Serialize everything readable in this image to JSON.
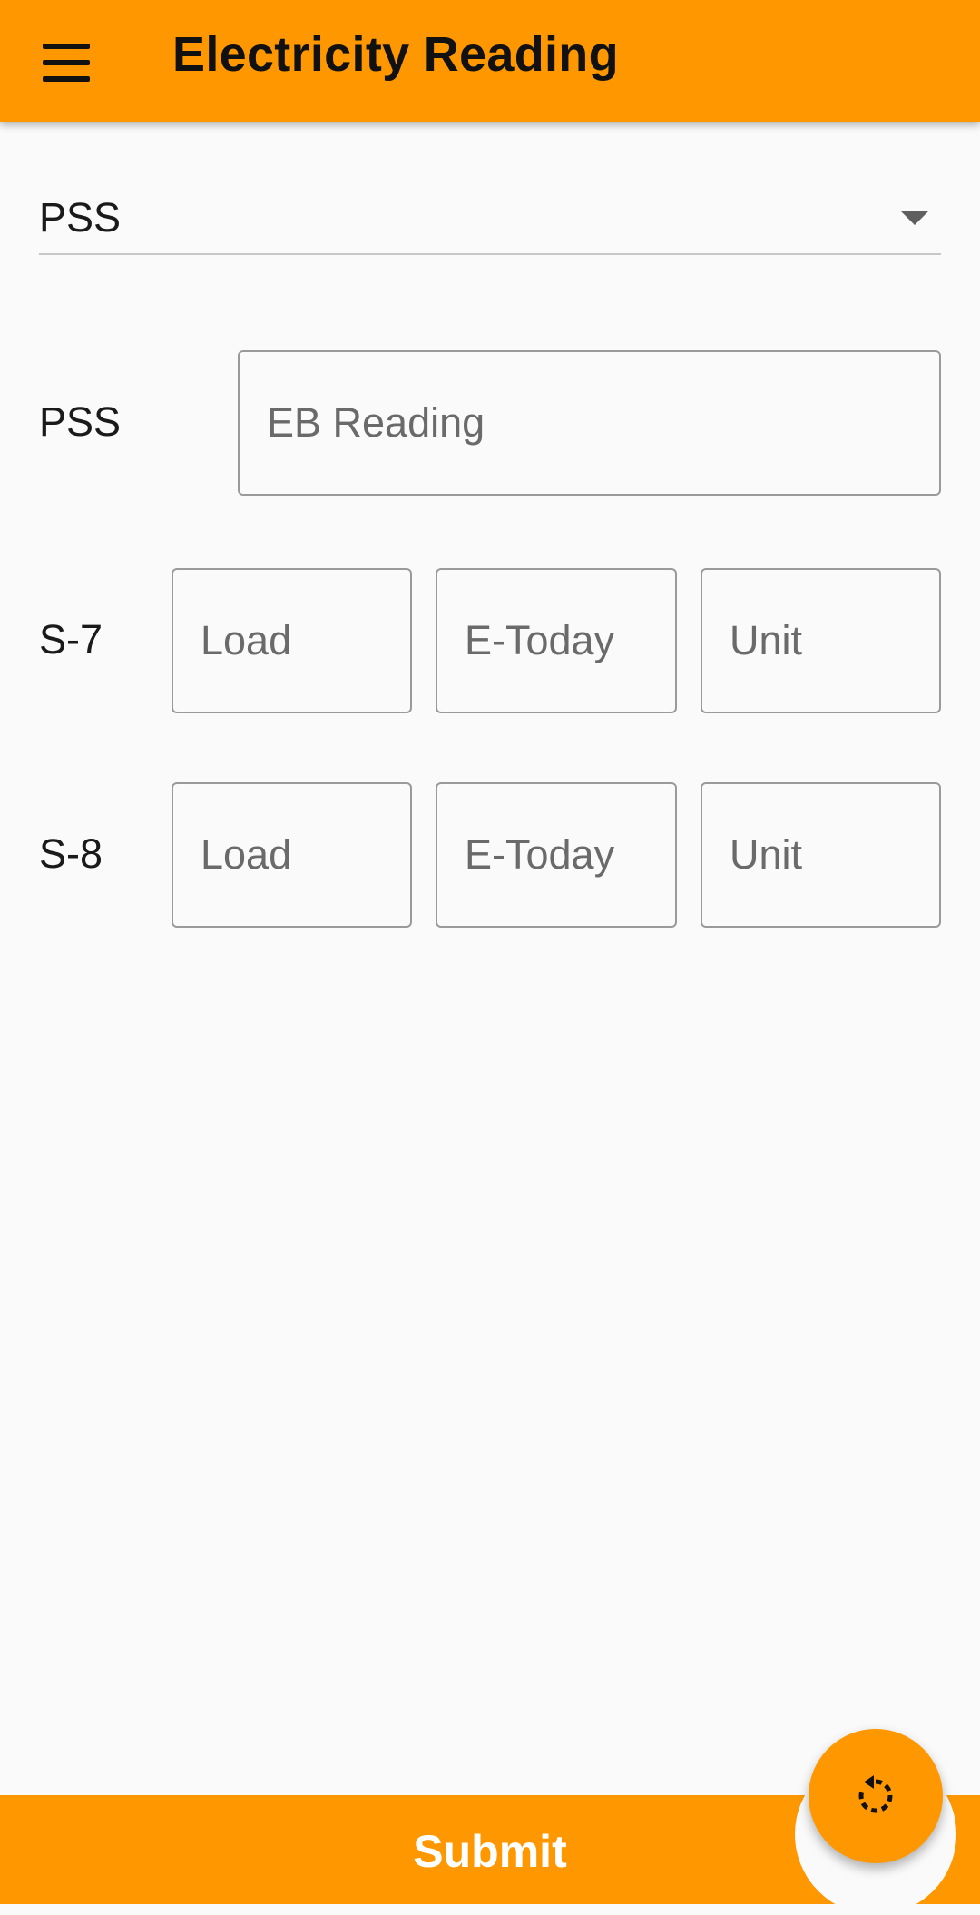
{
  "app_bar": {
    "title": "Electricity Reading",
    "menu_icon": "hamburger-menu-icon"
  },
  "dropdown": {
    "selected": "PSS",
    "caret_icon": "caret-down-icon"
  },
  "rows": {
    "pss": {
      "label": "PSS",
      "eb_reading_placeholder": "EB Reading",
      "eb_reading_value": ""
    },
    "s7": {
      "label": "S-7",
      "load_placeholder": "Load",
      "etoday_placeholder": "E-Today",
      "unit_placeholder": "Unit"
    },
    "s8": {
      "label": "S-8",
      "load_placeholder": "Load",
      "etoday_placeholder": "E-Today",
      "unit_placeholder": "Unit"
    }
  },
  "bottom_bar": {
    "submit_label": "Submit"
  },
  "fab": {
    "icon": "refresh-icon"
  },
  "colors": {
    "accent": "#ff9800",
    "background": "#fafafa",
    "field_border": "#9a9a9a"
  }
}
